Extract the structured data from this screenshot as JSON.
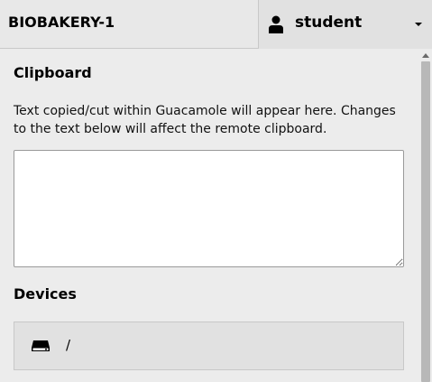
{
  "header": {
    "connection_name": "BIOBAKERY-1",
    "user_menu": {
      "username": "student",
      "icon": "user-icon",
      "caret": "chevron-down-icon"
    }
  },
  "clipboard": {
    "title": "Clipboard",
    "description": "Text copied/cut within Guacamole will appear here. Changes to the text below will affect the remote clipboard.",
    "text_value": ""
  },
  "devices": {
    "title": "Devices",
    "items": [
      {
        "label": "/",
        "icon": "drive-icon"
      }
    ]
  },
  "colors": {
    "header_bg": "#e8e8e8",
    "panel_bg": "#ececec",
    "device_bg": "#e1e1e1",
    "scroll_thumb": "#b8b8b8"
  }
}
